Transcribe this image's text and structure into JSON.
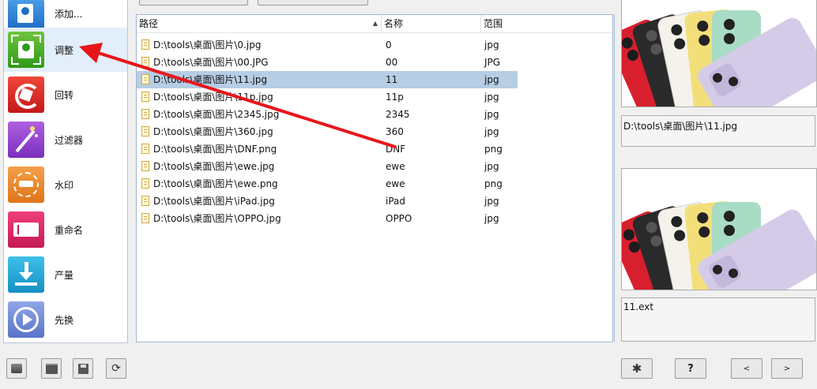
{
  "sidebar": {
    "items": [
      {
        "label": "添加...",
        "icon": "add-folder-icon"
      },
      {
        "label": "调整",
        "icon": "resize-icon"
      },
      {
        "label": "回转",
        "icon": "rotate-icon"
      },
      {
        "label": "过滤器",
        "icon": "magic-wand-icon"
      },
      {
        "label": "水印",
        "icon": "watermark-icon"
      },
      {
        "label": "重命名",
        "icon": "rename-icon"
      },
      {
        "label": "产量",
        "icon": "download-output-icon"
      },
      {
        "label": "先换",
        "icon": "play-convert-icon"
      }
    ],
    "selected_index": 1
  },
  "file_list": {
    "columns": {
      "path": "路径",
      "name": "名称",
      "range": "范围"
    },
    "sort_indicator": "▲",
    "rows": [
      {
        "path": "D:\\tools\\桌面\\图片\\0.jpg",
        "name": "0",
        "ext": "jpg"
      },
      {
        "path": "D:\\tools\\桌面\\图片\\00.JPG",
        "name": "00",
        "ext": "JPG"
      },
      {
        "path": "D:\\tools\\桌面\\图片\\11.jpg",
        "name": "11",
        "ext": "jpg"
      },
      {
        "path": "D:\\tools\\桌面\\图片\\11p.jpg",
        "name": "11p",
        "ext": "jpg"
      },
      {
        "path": "D:\\tools\\桌面\\图片\\2345.jpg",
        "name": "2345",
        "ext": "jpg"
      },
      {
        "path": "D:\\tools\\桌面\\图片\\360.jpg",
        "name": "360",
        "ext": "jpg"
      },
      {
        "path": "D:\\tools\\桌面\\图片\\DNF.png",
        "name": "DNF",
        "ext": "png"
      },
      {
        "path": "D:\\tools\\桌面\\图片\\ewe.jpg",
        "name": "ewe",
        "ext": "jpg"
      },
      {
        "path": "D:\\tools\\桌面\\图片\\ewe.png",
        "name": "ewe",
        "ext": "png"
      },
      {
        "path": "D:\\tools\\桌面\\图片\\iPad.jpg",
        "name": "iPad",
        "ext": "jpg"
      },
      {
        "path": "D:\\tools\\桌面\\图片\\OPPO.jpg",
        "name": "OPPO",
        "ext": "jpg"
      }
    ],
    "selected_row": 2
  },
  "preview": {
    "source_caption": "D:\\tools\\桌面\\图片\\11.jpg",
    "output_caption": "11.ext"
  },
  "bottom_toolbar": {
    "left_icons": [
      "clear-list-icon",
      "open-folder-icon",
      "save-icon",
      "refresh-icon"
    ],
    "settings_icon": "gear-icon",
    "help_label": "?",
    "prev_label": "<",
    "next_label": ">"
  },
  "colors": {
    "annotation_arrow": "#e8151b",
    "selection": "#b6cde4",
    "phone_purple": "#d4cbe8",
    "phone_green": "#a9dcc4",
    "phone_yellow": "#f3df7a",
    "phone_white": "#f4f2ea",
    "phone_black": "#2a2a2a",
    "phone_red": "#d81f2e"
  }
}
